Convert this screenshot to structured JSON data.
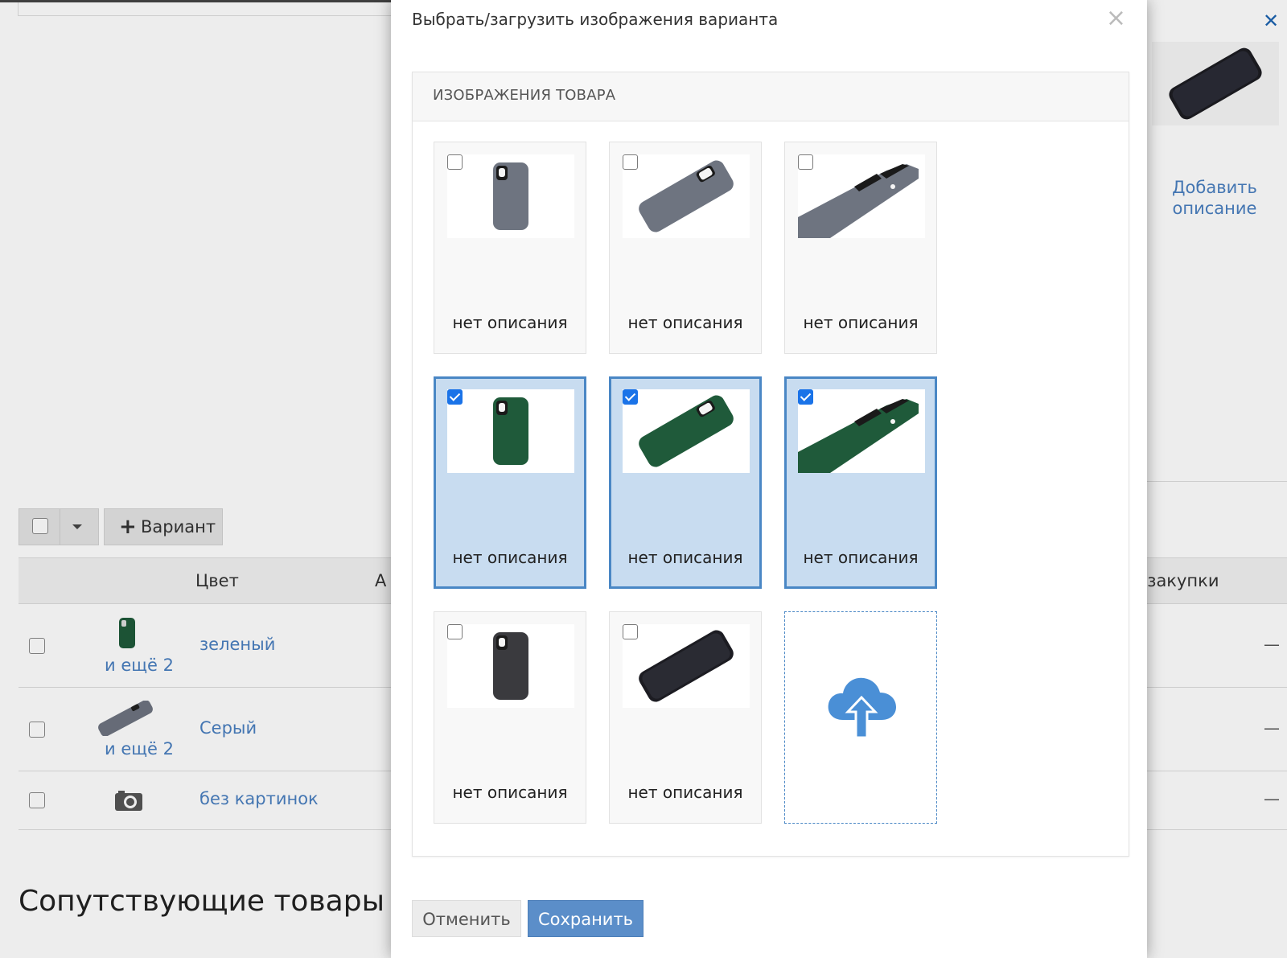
{
  "background": {
    "side_panel": {
      "add_description_link": "Добавить описание"
    },
    "toolbar": {
      "add_variant_button": "Вариант"
    },
    "table": {
      "headers": {
        "color": "Цвет",
        "partial": "А",
        "purchase_price": "на закупки"
      },
      "rows": [
        {
          "color": "зеленый",
          "more": "и ещё 2",
          "value": "—"
        },
        {
          "color": "Серый",
          "more": "и ещё 2",
          "value": "—"
        },
        {
          "color": "без картинок",
          "more": "",
          "value": "—"
        }
      ]
    },
    "related_title": "Сопутствующие товары"
  },
  "modal": {
    "title": "Выбрать/загрузить изображения варианта",
    "panel_title": "ИЗОБРАЖЕНИЯ ТОВАРА",
    "images": [
      {
        "description": "нет описания",
        "selected": false,
        "color": "#6e7480",
        "view": "back"
      },
      {
        "description": "нет описания",
        "selected": false,
        "color": "#6e7480",
        "view": "tilt"
      },
      {
        "description": "нет описания",
        "selected": false,
        "color": "#6e7480",
        "view": "edge"
      },
      {
        "description": "нет описания",
        "selected": true,
        "color": "#1f5a3a",
        "view": "back"
      },
      {
        "description": "нет описания",
        "selected": true,
        "color": "#1f5a3a",
        "view": "tilt"
      },
      {
        "description": "нет описания",
        "selected": true,
        "color": "#1f5a3a",
        "view": "edge"
      },
      {
        "description": "нет описания",
        "selected": false,
        "color": "#3a3a3e",
        "view": "back"
      },
      {
        "description": "нет описания",
        "selected": false,
        "color": "#1c1c22",
        "view": "tilt-black"
      }
    ],
    "upload_icon": "cloud-upload-icon",
    "buttons": {
      "cancel": "Отменить",
      "save": "Сохранить"
    },
    "accent_color": "#4a87c5"
  }
}
